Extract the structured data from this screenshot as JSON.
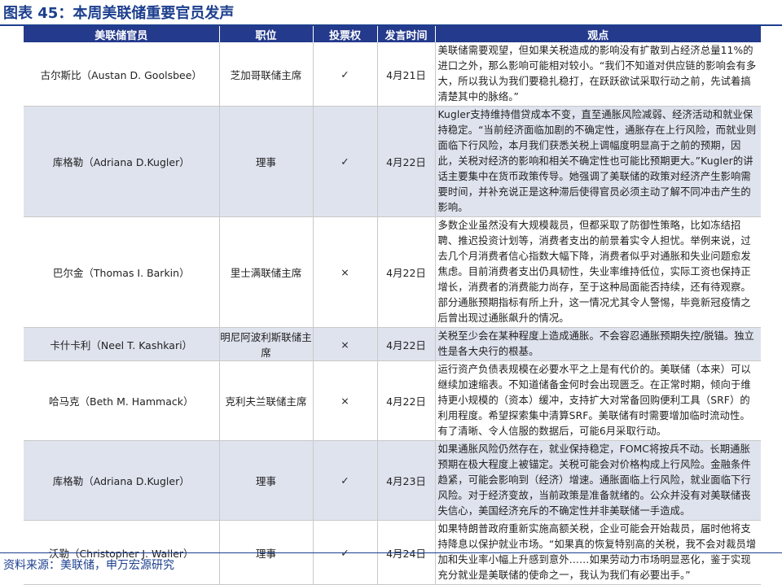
{
  "figure_title": "图表 45：本周美联储重要官员发声",
  "headers": [
    "美联储官员",
    "职位",
    "投票权",
    "发言时间",
    "观点"
  ],
  "rows": [
    {
      "name": "古尔斯比（Austan D. Goolsbee）",
      "position": "芝加哥联储主席",
      "vote": "✓",
      "date": "4月21日",
      "view": "美联储需要观望，但如果关税造成的影响没有扩散到占经济总量11%的进口之外，那么影响可能相对较小。“我们不知道对供应链的影响会有多大，所以我认为我们要稳扎稳打，在跃跃欲试采取行动之前，先试着搞清楚其中的脉络。”"
    },
    {
      "name": "库格勒（Adriana D.Kugler）",
      "position": "理事",
      "vote": "✓",
      "date": "4月22日",
      "view": "Kugler支持维持借贷成本不变，直至通胀风险减弱、经济活动和就业保持稳定。“当前经济面临加剧的不确定性，通胀存在上行风险，而就业则面临下行风险，本月我们获悉关税上调幅度明显高于之前的预期，因此，关税对经济的影响和相关不确定性也可能比预期更大。”Kugler的讲话主要集中在货币政策传导。她强调了美联储的政策对经济产生影响需要时间，并补充说正是这种滞后使得官员必须主动了解不同冲击产生的影响。"
    },
    {
      "name": "巴尔金（Thomas I. Barkin）",
      "position": "里士满联储主席",
      "vote": "×",
      "date": "4月22日",
      "view": "多数企业虽然没有大规模裁员，但都采取了防御性策略，比如冻结招聘、推迟投资计划等，消费者支出的前景着实令人担忧。举例来说，过去几个月消费者信心指数大幅下降，消费者似乎对通胀和失业问题愈发焦虑。目前消费者支出仍具韧性，失业率维持低位，实际工资也保持正增长，消费者的消费能力尚存，至于这种局面能否持续，还有待观察。部分通胀预期指标有所上升，这一情况尤其令人警惕，毕竟新冠疫情之后曾出现过通胀飙升的情况。"
    },
    {
      "name": "卡什卡利（Neel T. Kashkari）",
      "position": "明尼阿波利斯联储主席",
      "vote": "×",
      "date": "4月22日",
      "view": "关税至少会在某种程度上造成通胀。不会容忍通胀预期失控/脱锚。独立性是各大央行的根基。"
    },
    {
      "name": "哈马克（Beth M. Hammack）",
      "position": "克利夫兰联储主席",
      "vote": "×",
      "date": "4月22日",
      "view": "运行资产负债表规模在必要水平之上是有代价的。美联储（本来）可以继续加速缩表。不知道储备金何时会出现匮乏。在正常时期，倾向于维持更小规模的（资本）缓冲，支持扩大对常备回购便利工具（SRF）的利用程度。希望探索集中清算SRF。美联储有时需要增加临时流动性。有了清晰、令人信服的数据后，可能6月采取行动。"
    },
    {
      "name": "库格勒（Adriana D.Kugler）",
      "position": "理事",
      "vote": "✓",
      "date": "4月23日",
      "view": "如果通胀风险仍然存在，就业保持稳定，FOMC将按兵不动。长期通胀预期在极大程度上被锚定。关税可能会对价格构成上行风险。金融条件趋紧，可能会影响到（经济）增速。通胀面临上行风险，就业面临下行风险。对于经济变故，当前政策是准备就绪的。公众并没有对美联储丧失信心，美国经济充斥的不确定性并非美联储一手造成。"
    },
    {
      "name": "沃勒（Christopher J. Waller）",
      "position": "理事",
      "vote": "✓",
      "date": "4月24日",
      "view": "如果特朗普政府重新实施高额关税，企业可能会开始裁员，届时他将支持降息以保护就业市场。“如果真的恢复特别高的关税，我不会对裁员增加和失业率小幅上升感到意外……如果劳动力市场明显恶化，鉴于实现充分就业是美联储的使命之一，我认为我们有必要出手。”"
    }
  ],
  "source": "资料来源：美联储，申万宏源研究",
  "colors": {
    "header_bg": "#243a8c",
    "shade_bg": "#dfe3ee",
    "title": "#1d3f8f"
  }
}
